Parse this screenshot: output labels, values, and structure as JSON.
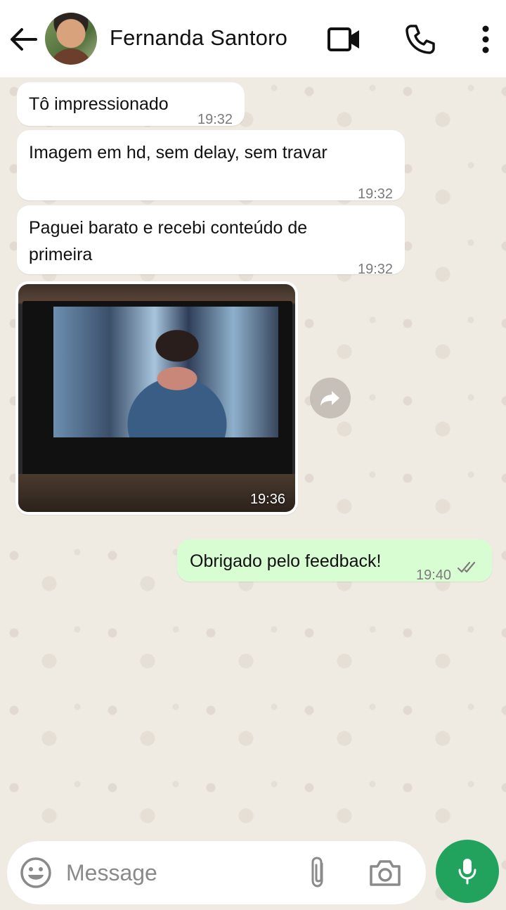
{
  "header": {
    "contact_name": "Fernanda Santoro",
    "icons": [
      "back-arrow-icon",
      "avatar",
      "video-call-icon",
      "phone-icon",
      "more-vert-icon"
    ]
  },
  "messages": [
    {
      "direction": "incoming",
      "text": "Tô impressionado",
      "time": "19:32"
    },
    {
      "direction": "incoming",
      "text": "Imagem em hd, sem delay, sem travar",
      "time": "19:32"
    },
    {
      "direction": "incoming",
      "text_line1": "Paguei barato e recebi conteúdo de",
      "text_line2": "primeira",
      "time": "19:32"
    },
    {
      "direction": "incoming",
      "type": "image",
      "time": "19:36"
    },
    {
      "direction": "outgoing",
      "text": "Obrigado pelo feedback!",
      "time": "19:40",
      "status": "read"
    }
  ],
  "composer": {
    "placeholder": "Message"
  },
  "colors": {
    "outgoing_bubble": "#d9fdd3",
    "incoming_bubble": "#ffffff",
    "accent": "#21a35d",
    "chat_background": "#efeae2"
  }
}
